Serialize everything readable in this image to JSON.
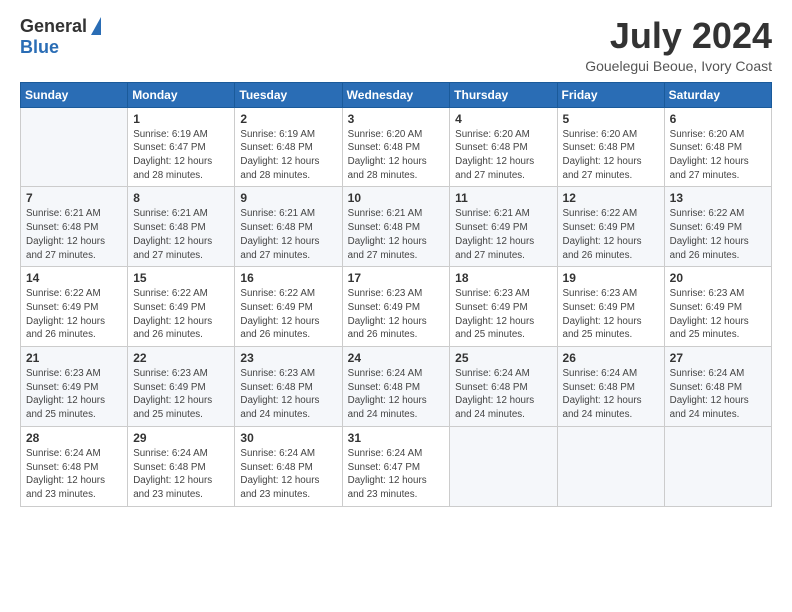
{
  "logo": {
    "general": "General",
    "blue": "Blue"
  },
  "header": {
    "month_title": "July 2024",
    "subtitle": "Gouelegui Beoue, Ivory Coast"
  },
  "days_of_week": [
    "Sunday",
    "Monday",
    "Tuesday",
    "Wednesday",
    "Thursday",
    "Friday",
    "Saturday"
  ],
  "weeks": [
    [
      {
        "day": "",
        "sunrise": "",
        "sunset": "",
        "daylight": ""
      },
      {
        "day": "1",
        "sunrise": "Sunrise: 6:19 AM",
        "sunset": "Sunset: 6:47 PM",
        "daylight": "Daylight: 12 hours and 28 minutes."
      },
      {
        "day": "2",
        "sunrise": "Sunrise: 6:19 AM",
        "sunset": "Sunset: 6:48 PM",
        "daylight": "Daylight: 12 hours and 28 minutes."
      },
      {
        "day": "3",
        "sunrise": "Sunrise: 6:20 AM",
        "sunset": "Sunset: 6:48 PM",
        "daylight": "Daylight: 12 hours and 28 minutes."
      },
      {
        "day": "4",
        "sunrise": "Sunrise: 6:20 AM",
        "sunset": "Sunset: 6:48 PM",
        "daylight": "Daylight: 12 hours and 27 minutes."
      },
      {
        "day": "5",
        "sunrise": "Sunrise: 6:20 AM",
        "sunset": "Sunset: 6:48 PM",
        "daylight": "Daylight: 12 hours and 27 minutes."
      },
      {
        "day": "6",
        "sunrise": "Sunrise: 6:20 AM",
        "sunset": "Sunset: 6:48 PM",
        "daylight": "Daylight: 12 hours and 27 minutes."
      }
    ],
    [
      {
        "day": "7",
        "sunrise": "Sunrise: 6:21 AM",
        "sunset": "Sunset: 6:48 PM",
        "daylight": "Daylight: 12 hours and 27 minutes."
      },
      {
        "day": "8",
        "sunrise": "Sunrise: 6:21 AM",
        "sunset": "Sunset: 6:48 PM",
        "daylight": "Daylight: 12 hours and 27 minutes."
      },
      {
        "day": "9",
        "sunrise": "Sunrise: 6:21 AM",
        "sunset": "Sunset: 6:48 PM",
        "daylight": "Daylight: 12 hours and 27 minutes."
      },
      {
        "day": "10",
        "sunrise": "Sunrise: 6:21 AM",
        "sunset": "Sunset: 6:48 PM",
        "daylight": "Daylight: 12 hours and 27 minutes."
      },
      {
        "day": "11",
        "sunrise": "Sunrise: 6:21 AM",
        "sunset": "Sunset: 6:49 PM",
        "daylight": "Daylight: 12 hours and 27 minutes."
      },
      {
        "day": "12",
        "sunrise": "Sunrise: 6:22 AM",
        "sunset": "Sunset: 6:49 PM",
        "daylight": "Daylight: 12 hours and 26 minutes."
      },
      {
        "day": "13",
        "sunrise": "Sunrise: 6:22 AM",
        "sunset": "Sunset: 6:49 PM",
        "daylight": "Daylight: 12 hours and 26 minutes."
      }
    ],
    [
      {
        "day": "14",
        "sunrise": "Sunrise: 6:22 AM",
        "sunset": "Sunset: 6:49 PM",
        "daylight": "Daylight: 12 hours and 26 minutes."
      },
      {
        "day": "15",
        "sunrise": "Sunrise: 6:22 AM",
        "sunset": "Sunset: 6:49 PM",
        "daylight": "Daylight: 12 hours and 26 minutes."
      },
      {
        "day": "16",
        "sunrise": "Sunrise: 6:22 AM",
        "sunset": "Sunset: 6:49 PM",
        "daylight": "Daylight: 12 hours and 26 minutes."
      },
      {
        "day": "17",
        "sunrise": "Sunrise: 6:23 AM",
        "sunset": "Sunset: 6:49 PM",
        "daylight": "Daylight: 12 hours and 26 minutes."
      },
      {
        "day": "18",
        "sunrise": "Sunrise: 6:23 AM",
        "sunset": "Sunset: 6:49 PM",
        "daylight": "Daylight: 12 hours and 25 minutes."
      },
      {
        "day": "19",
        "sunrise": "Sunrise: 6:23 AM",
        "sunset": "Sunset: 6:49 PM",
        "daylight": "Daylight: 12 hours and 25 minutes."
      },
      {
        "day": "20",
        "sunrise": "Sunrise: 6:23 AM",
        "sunset": "Sunset: 6:49 PM",
        "daylight": "Daylight: 12 hours and 25 minutes."
      }
    ],
    [
      {
        "day": "21",
        "sunrise": "Sunrise: 6:23 AM",
        "sunset": "Sunset: 6:49 PM",
        "daylight": "Daylight: 12 hours and 25 minutes."
      },
      {
        "day": "22",
        "sunrise": "Sunrise: 6:23 AM",
        "sunset": "Sunset: 6:49 PM",
        "daylight": "Daylight: 12 hours and 25 minutes."
      },
      {
        "day": "23",
        "sunrise": "Sunrise: 6:23 AM",
        "sunset": "Sunset: 6:48 PM",
        "daylight": "Daylight: 12 hours and 24 minutes."
      },
      {
        "day": "24",
        "sunrise": "Sunrise: 6:24 AM",
        "sunset": "Sunset: 6:48 PM",
        "daylight": "Daylight: 12 hours and 24 minutes."
      },
      {
        "day": "25",
        "sunrise": "Sunrise: 6:24 AM",
        "sunset": "Sunset: 6:48 PM",
        "daylight": "Daylight: 12 hours and 24 minutes."
      },
      {
        "day": "26",
        "sunrise": "Sunrise: 6:24 AM",
        "sunset": "Sunset: 6:48 PM",
        "daylight": "Daylight: 12 hours and 24 minutes."
      },
      {
        "day": "27",
        "sunrise": "Sunrise: 6:24 AM",
        "sunset": "Sunset: 6:48 PM",
        "daylight": "Daylight: 12 hours and 24 minutes."
      }
    ],
    [
      {
        "day": "28",
        "sunrise": "Sunrise: 6:24 AM",
        "sunset": "Sunset: 6:48 PM",
        "daylight": "Daylight: 12 hours and 23 minutes."
      },
      {
        "day": "29",
        "sunrise": "Sunrise: 6:24 AM",
        "sunset": "Sunset: 6:48 PM",
        "daylight": "Daylight: 12 hours and 23 minutes."
      },
      {
        "day": "30",
        "sunrise": "Sunrise: 6:24 AM",
        "sunset": "Sunset: 6:48 PM",
        "daylight": "Daylight: 12 hours and 23 minutes."
      },
      {
        "day": "31",
        "sunrise": "Sunrise: 6:24 AM",
        "sunset": "Sunset: 6:47 PM",
        "daylight": "Daylight: 12 hours and 23 minutes."
      },
      {
        "day": "",
        "sunrise": "",
        "sunset": "",
        "daylight": ""
      },
      {
        "day": "",
        "sunrise": "",
        "sunset": "",
        "daylight": ""
      },
      {
        "day": "",
        "sunrise": "",
        "sunset": "",
        "daylight": ""
      }
    ]
  ]
}
